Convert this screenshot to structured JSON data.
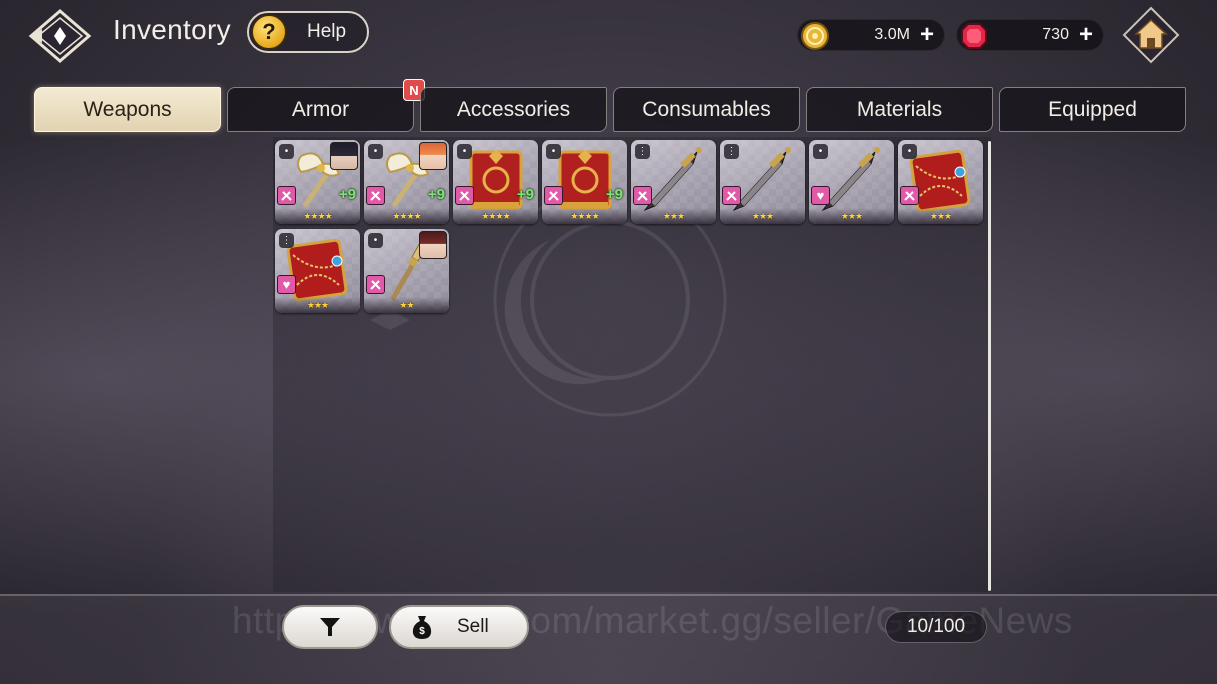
{
  "header": {
    "title": "Inventory",
    "help_label": "Help",
    "help_glyph": "?",
    "back_icon": "diamond-back-icon",
    "home_icon": "home-icon"
  },
  "currencies": [
    {
      "name": "gold",
      "icon": "gold-coin-icon",
      "value": "3.0M",
      "plus": "+",
      "color": "#e8b638"
    },
    {
      "name": "gem",
      "icon": "red-gem-icon",
      "value": "730",
      "plus": "+",
      "color": "#e0284a"
    }
  ],
  "tabs": [
    {
      "label": "Weapons",
      "active": true
    },
    {
      "label": "Armor",
      "active": false,
      "badge": "N"
    },
    {
      "label": "Accessories",
      "active": false
    },
    {
      "label": "Consumables",
      "active": false
    },
    {
      "label": "Materials",
      "active": false
    },
    {
      "label": "Equipped",
      "active": false
    }
  ],
  "items": [
    {
      "art": "golden-axe",
      "stars": "★★★★",
      "level": "+9",
      "tag": "•",
      "badge": "weapon",
      "portrait": "dark-hair"
    },
    {
      "art": "golden-axe",
      "stars": "★★★★",
      "level": "+9",
      "tag": "•",
      "badge": "weapon",
      "portrait": "orange-hair"
    },
    {
      "art": "red-tome",
      "stars": "★★★★",
      "level": "+9",
      "tag": "•",
      "badge": "weapon",
      "portrait": null
    },
    {
      "art": "red-tome",
      "stars": "★★★★",
      "level": "+9",
      "tag": "•",
      "badge": "weapon",
      "portrait": null
    },
    {
      "art": "dagger",
      "stars": "★★★",
      "level": "",
      "tag": "⋮",
      "badge": "weapon",
      "portrait": null
    },
    {
      "art": "dagger",
      "stars": "★★★",
      "level": "",
      "tag": "⋮",
      "badge": "weapon",
      "portrait": null
    },
    {
      "art": "dagger",
      "stars": "★★★",
      "level": "",
      "tag": "•",
      "badge": "heart",
      "portrait": null
    },
    {
      "art": "chained-tome",
      "stars": "★★★",
      "level": "",
      "tag": "•",
      "badge": "weapon",
      "portrait": null
    },
    {
      "art": "chained-tome",
      "stars": "★★★",
      "level": "",
      "tag": "⋮",
      "badge": "heart",
      "portrait": null
    },
    {
      "art": "spear",
      "stars": "★★",
      "level": "",
      "tag": "•",
      "badge": "weapon",
      "portrait": "red-hair"
    }
  ],
  "footer": {
    "filter_icon": "filter-icon",
    "sell_label": "Sell",
    "sell_icon": "money-bag-icon",
    "capacity": "10/100",
    "watermark": "https://www.g2g.com/market.gg/seller/GameNews"
  }
}
